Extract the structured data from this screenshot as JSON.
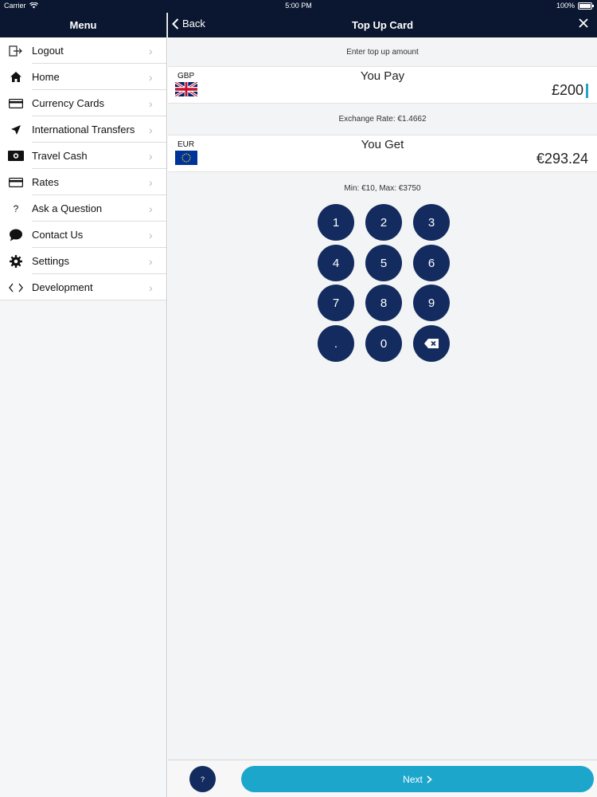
{
  "status_bar": {
    "carrier": "Carrier",
    "time": "5:00 PM",
    "battery": "100%"
  },
  "sidebar": {
    "title": "Menu",
    "items": [
      {
        "label": "Logout",
        "icon": "logout-icon"
      },
      {
        "label": "Home",
        "icon": "home-icon"
      },
      {
        "label": "Currency Cards",
        "icon": "card-icon"
      },
      {
        "label": "International Transfers",
        "icon": "send-arrow-icon"
      },
      {
        "label": "Travel Cash",
        "icon": "cash-icon"
      },
      {
        "label": "Rates",
        "icon": "rates-card-icon"
      },
      {
        "label": "Ask a Question",
        "icon": "question-icon"
      },
      {
        "label": "Contact Us",
        "icon": "chat-bubble-icon"
      },
      {
        "label": "Settings",
        "icon": "gear-icon"
      },
      {
        "label": "Development",
        "icon": "code-icon"
      }
    ]
  },
  "navbar": {
    "back_label": "Back",
    "title": "Top Up Card"
  },
  "prompt": "Enter top up amount",
  "pay": {
    "code": "GBP",
    "label": "You Pay",
    "amount": "£200"
  },
  "exchange_rate": "Exchange Rate: €1.4662",
  "get": {
    "code": "EUR",
    "label": "You Get",
    "amount": "€293.24"
  },
  "limits": "Min: €10, Max: €3750",
  "keypad": {
    "keys": [
      "1",
      "2",
      "3",
      "4",
      "5",
      "6",
      "7",
      "8",
      "9",
      ".",
      "0"
    ],
    "delete_icon": "backspace-icon"
  },
  "bottom": {
    "help_label": "?",
    "next_label": "Next"
  },
  "colors": {
    "nav": "#0b1730",
    "keys": "#132b5e",
    "accent": "#1da6cc"
  }
}
